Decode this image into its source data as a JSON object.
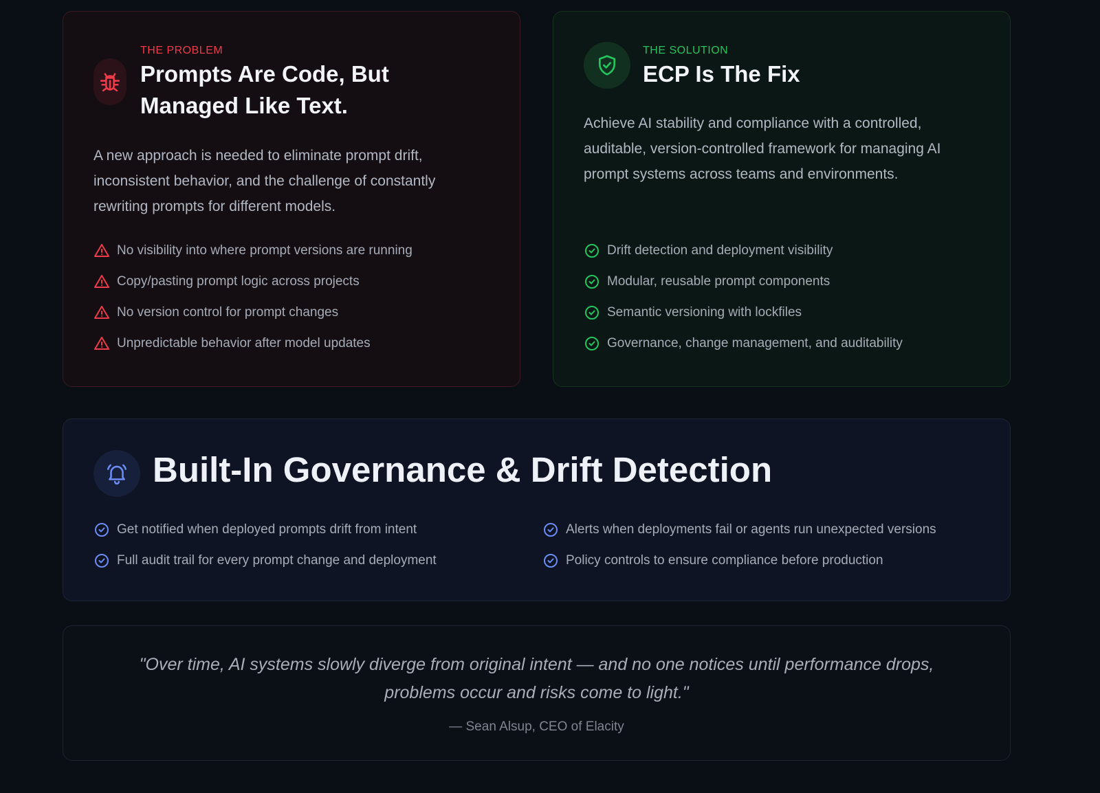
{
  "problem": {
    "eyebrow": "THE PROBLEM",
    "title_line1": "Prompts Are Code, But",
    "title_line2": "Managed Like Text.",
    "description": "A new approach is needed to eliminate prompt drift, inconsistent behavior, and the challenge of constantly rewriting prompts for different models.",
    "icon": "bug-icon",
    "accent": "#ef3b4a",
    "items": [
      "No visibility into where prompt versions are running",
      "Copy/pasting prompt logic across projects",
      "No version control for prompt changes",
      "Unpredictable behavior after model updates"
    ]
  },
  "solution": {
    "eyebrow": "THE SOLUTION",
    "title": "ECP Is The Fix",
    "description": "Achieve AI stability and compliance with a controlled, auditable, version-controlled framework for managing AI prompt systems across teams and environments.",
    "icon": "shield-check-icon",
    "accent": "#22c55e",
    "items": [
      "Drift detection and deployment visibility",
      "Modular, reusable prompt components",
      "Semantic versioning with lockfiles",
      "Governance, change management, and auditability"
    ]
  },
  "governance": {
    "title": "Built-In Governance & Drift Detection",
    "icon": "bell-icon",
    "accent": "#6b8cf5",
    "items_left": [
      "Get notified when deployed prompts drift from intent",
      "Full audit trail for every prompt change and deployment"
    ],
    "items_right": [
      "Alerts when deployments fail or agents run unexpected versions",
      "Policy controls to ensure compliance before production"
    ]
  },
  "quote": {
    "text": "\"Over time, AI systems slowly diverge from original intent — and no one notices until performance drops, problems occur and risks come to light.\"",
    "attribution": "— Sean Alsup, CEO of Elacity"
  }
}
